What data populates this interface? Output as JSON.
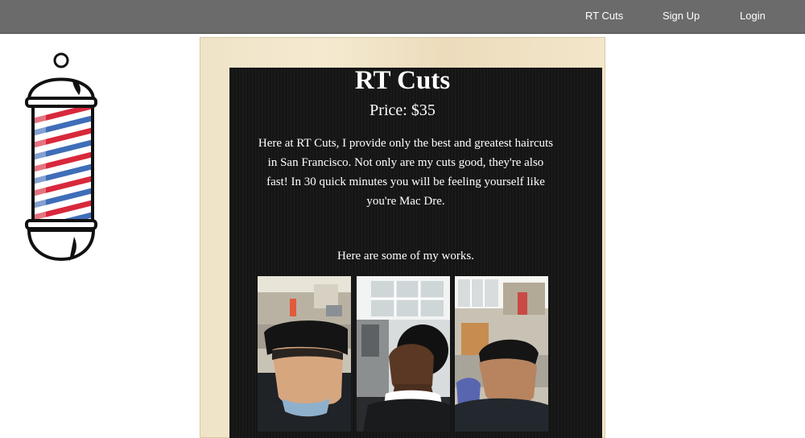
{
  "nav": {
    "links": [
      {
        "label": "RT Cuts"
      },
      {
        "label": "Sign Up"
      },
      {
        "label": "Login"
      }
    ],
    "bg_color": "#6b6b6b"
  },
  "logo": {
    "icon": "barber-pole-icon",
    "stripe_colors": [
      "#d8283c",
      "#3f6db8"
    ]
  },
  "board": {
    "title": "RT Cuts",
    "price": "Price: $35",
    "description": "Here at RT Cuts, I provide only the best and greatest haircuts in San Francisco. Not only are my cuts good, they're also fast! In 30 quick minutes you will be feeling yourself like you're Mac Dre.",
    "works_heading": "Here are some of my works.",
    "photos": [
      {
        "icon": "haircut-photo-1"
      },
      {
        "icon": "haircut-photo-2"
      },
      {
        "icon": "haircut-photo-3"
      }
    ]
  }
}
